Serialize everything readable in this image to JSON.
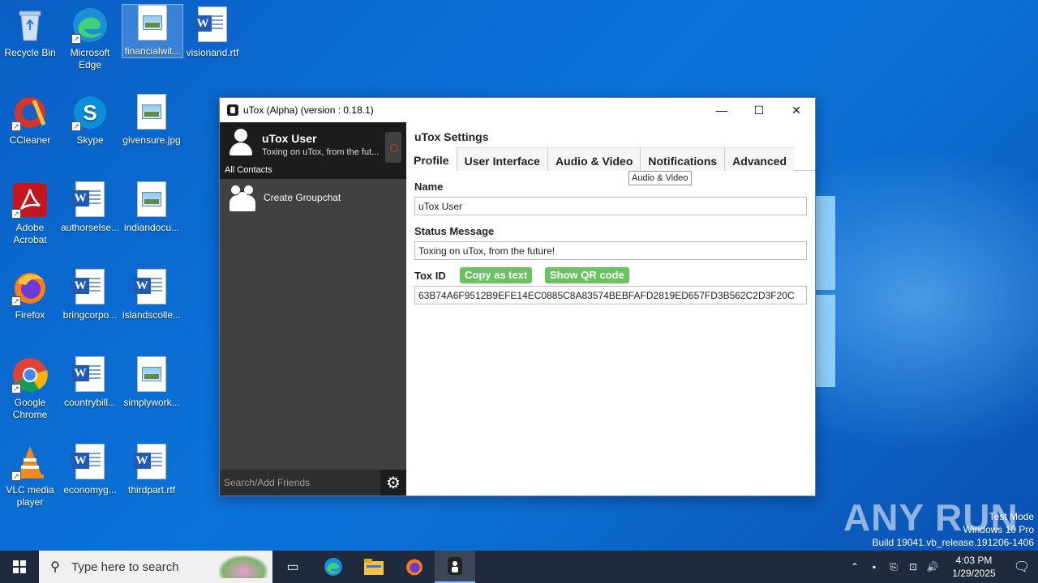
{
  "desktop": {
    "icons": [
      {
        "label": "Recycle Bin"
      },
      {
        "label": "Microsoft Edge"
      },
      {
        "label": "financialwit..."
      },
      {
        "label": "visionand.rtf"
      },
      {
        "label": "CCleaner"
      },
      {
        "label": "Skype"
      },
      {
        "label": "givensure.jpg"
      },
      {
        "label": "Adobe Acrobat"
      },
      {
        "label": "authorselse..."
      },
      {
        "label": "indiandocu..."
      },
      {
        "label": "Firefox"
      },
      {
        "label": "bringcorpo..."
      },
      {
        "label": "islandscolle..."
      },
      {
        "label": "Google Chrome"
      },
      {
        "label": "countrybill..."
      },
      {
        "label": "simplywork..."
      },
      {
        "label": "VLC media player"
      },
      {
        "label": "economyg..."
      },
      {
        "label": "thirdpart.rtf"
      }
    ]
  },
  "window": {
    "title": "uTox (Alpha) (version : 0.18.1)",
    "minimize": "—",
    "maximize": "☐",
    "close": "✕"
  },
  "sidebar": {
    "self_name": "uTox User",
    "self_status": "Toxing on uTox, from the fut...",
    "filter_label": "All Contacts",
    "create_group": "Create Groupchat",
    "search_placeholder": "Search/Add Friends",
    "settings_icon": "gear-icon"
  },
  "settings": {
    "title": "uTox Settings",
    "tabs": [
      {
        "label": "Profile",
        "active": true
      },
      {
        "label": "User Interface"
      },
      {
        "label": "Audio & Video"
      },
      {
        "label": "Notifications"
      },
      {
        "label": "Advanced"
      }
    ],
    "tooltip": "Audio & Video",
    "name_label": "Name",
    "name_value": "uTox User",
    "status_label": "Status Message",
    "status_value": "Toxing on uTox, from the future!",
    "toxid_label": "Tox ID",
    "copy_button": "Copy as text",
    "qr_button": "Show QR code",
    "toxid_value": "63B74A6F9512B9EFE14EC0885C8A83574BEBFAFD2819ED657FD3B562C2D3F20C"
  },
  "taskbar": {
    "search_placeholder": "Type here to search",
    "time": "4:03 PM",
    "date": "1/29/2025"
  },
  "watermark": {
    "brand": "ANY RUN",
    "line1": "Test Mode",
    "line2": "Windows 10 Pro",
    "line3": "Build 19041.vb_release.191206-1406"
  },
  "colors": {
    "accent_green": "#6bc260",
    "sidebar_dark": "#1c1c1c",
    "sidebar_bg": "#414141",
    "desktop_blue": "#0b73d9"
  }
}
